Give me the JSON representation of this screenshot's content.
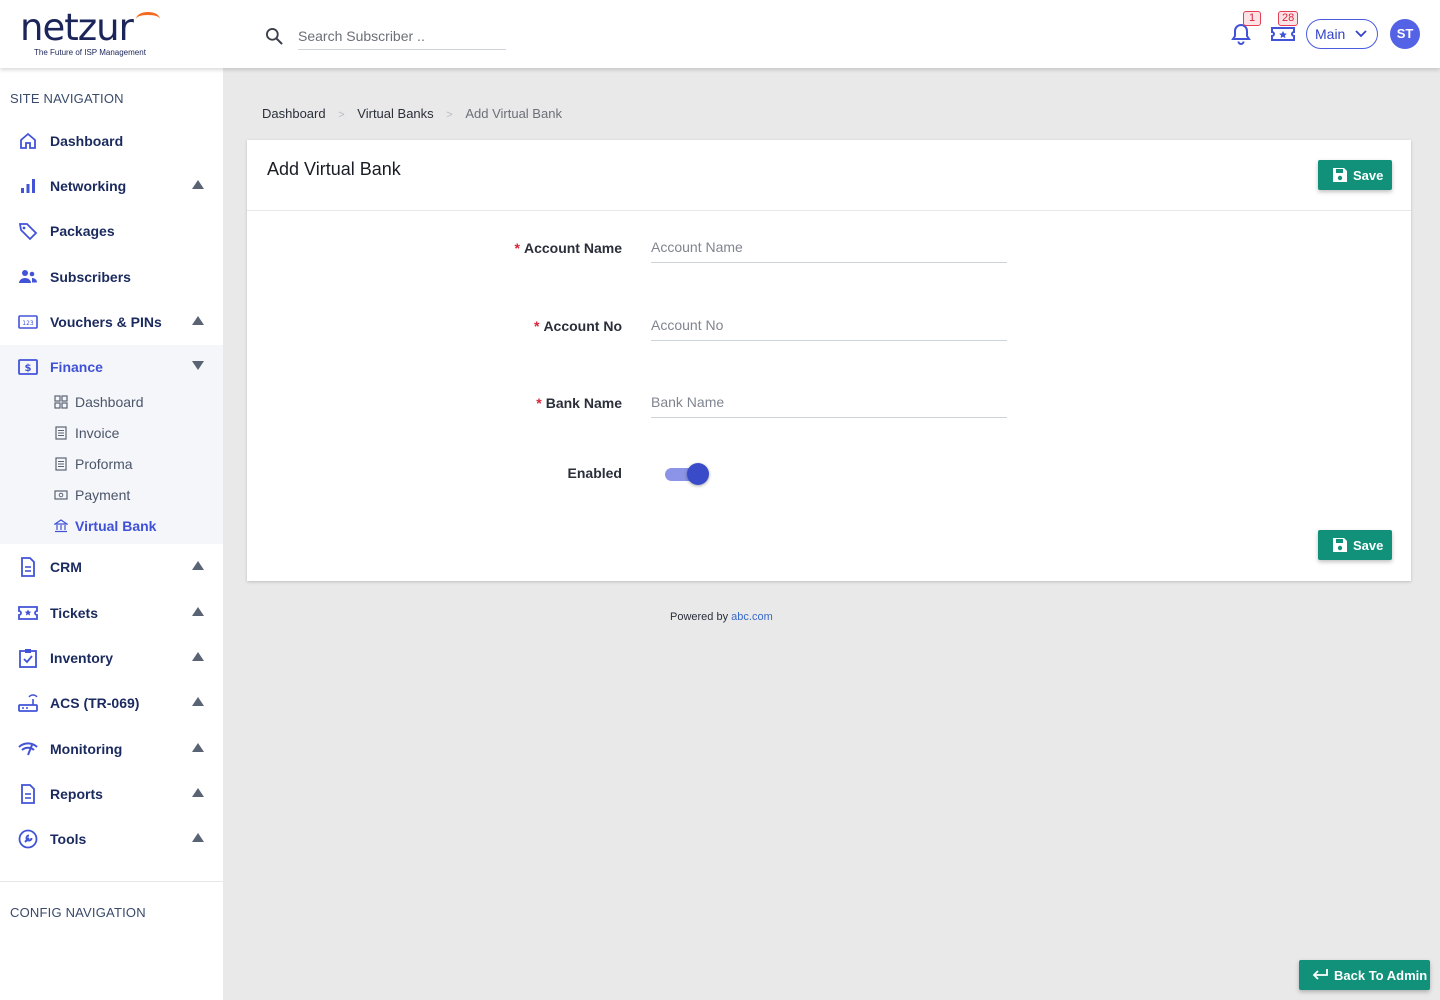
{
  "brand": {
    "name": "netzur",
    "tagline": "The Future of ISP Management"
  },
  "header": {
    "search_placeholder": "Search Subscriber ..",
    "notifications_count": "1",
    "tickets_count": "28",
    "workspace": "Main",
    "user_initials": "ST"
  },
  "sidebar": {
    "site_nav_title": "SITE NAVIGATION",
    "config_nav_title": "CONFIG NAVIGATION",
    "items": [
      {
        "label": "Dashboard"
      },
      {
        "label": "Networking"
      },
      {
        "label": "Packages"
      },
      {
        "label": "Subscribers"
      },
      {
        "label": "Vouchers & PINs"
      },
      {
        "label": "Finance"
      },
      {
        "label": "CRM"
      },
      {
        "label": "Tickets"
      },
      {
        "label": "Inventory"
      },
      {
        "label": "ACS (TR-069)"
      },
      {
        "label": "Monitoring"
      },
      {
        "label": "Reports"
      },
      {
        "label": "Tools"
      }
    ],
    "finance_sub": [
      {
        "label": "Dashboard"
      },
      {
        "label": "Invoice"
      },
      {
        "label": "Proforma"
      },
      {
        "label": "Payment"
      },
      {
        "label": "Virtual Bank"
      }
    ]
  },
  "breadcrumb": [
    "Dashboard",
    "Virtual Banks",
    "Add Virtual Bank"
  ],
  "form": {
    "title": "Add Virtual Bank",
    "save_label": "Save",
    "required_mark": "*",
    "fields": [
      {
        "label": "Account Name",
        "placeholder": "Account Name",
        "value": ""
      },
      {
        "label": "Account No",
        "placeholder": "Account No",
        "value": ""
      },
      {
        "label": "Bank Name",
        "placeholder": "Bank Name",
        "value": ""
      }
    ],
    "enabled_label": "Enabled",
    "enabled": true
  },
  "footer": {
    "powered_prefix": "Powered by",
    "powered_link": "abc.com"
  },
  "back_button": "Back To Admin",
  "colors": {
    "primary": "#3f51d6",
    "accent": "#11907a",
    "danger": "#d8243b",
    "brand_orange": "#f26b21"
  }
}
